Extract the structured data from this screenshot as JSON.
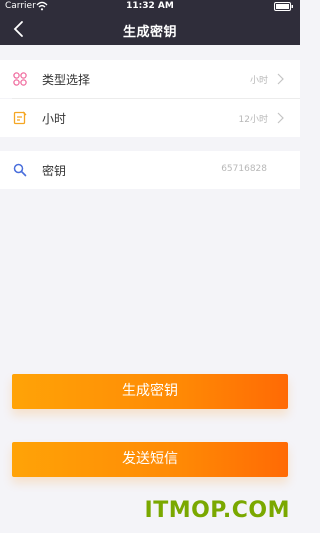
{
  "status_bar": {
    "carrier": "Carrier",
    "time": "11:32 AM"
  },
  "nav": {
    "title": "生成密钥"
  },
  "rows": [
    {
      "label": "类型选择",
      "value": "小时",
      "icon": "grid-icon"
    },
    {
      "label": "小时",
      "value": "12小时",
      "icon": "note-icon"
    },
    {
      "label": "密钥",
      "value": "65716828",
      "icon": "search-icon"
    }
  ],
  "buttons": {
    "generate": "生成密钥",
    "send_sms": "发送短信"
  },
  "watermark": "ITMOP.COM",
  "colors": {
    "header": "#2f2d3a",
    "accent": "#ff8a05",
    "icon_pink": "#f06ea0",
    "icon_orange": "#f5a623",
    "icon_blue": "#4a6fdc"
  }
}
